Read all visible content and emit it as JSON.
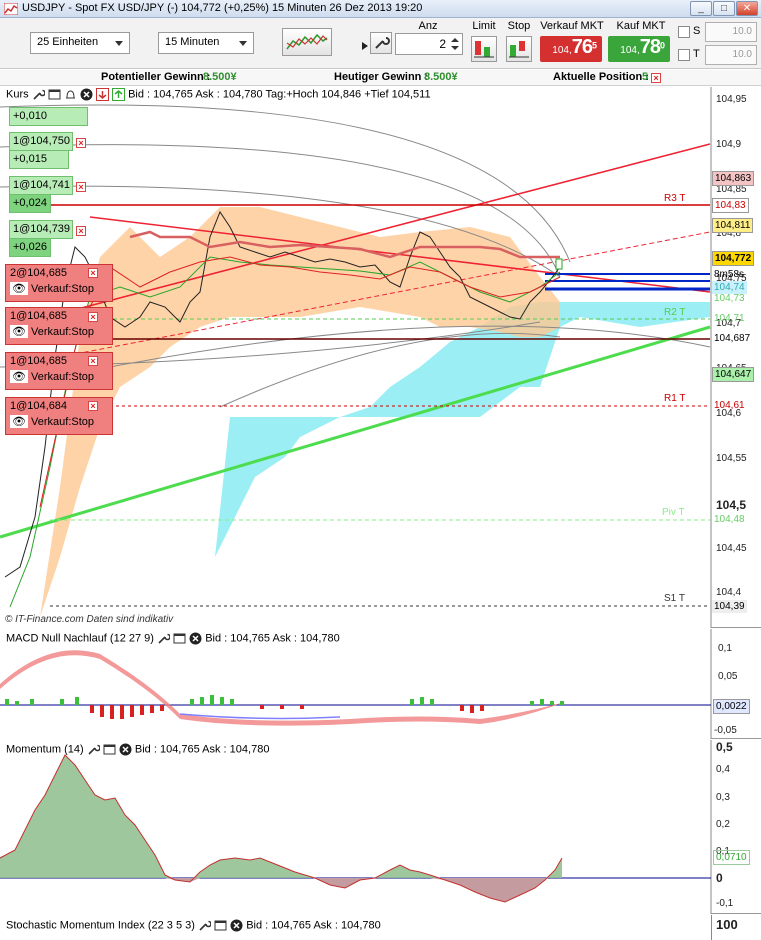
{
  "window": {
    "title": "USDJPY - Spot FX USD/JPY (-)    104,772 (+0,25%)    15 Minuten   26 Dez 2013 19:20",
    "buttons": {
      "minimize": "_",
      "maximize": "□",
      "close": "✕"
    }
  },
  "toolbar": {
    "units_select": "25 Einheiten",
    "interval_select": "15 Minuten",
    "anz_label": "Anz",
    "anz_value": "2",
    "limit_label": "Limit",
    "stop_label": "Stop",
    "sell_label": "Verkauf MKT",
    "buy_label": "Kauf MKT",
    "sell_price": {
      "small": "104,",
      "big": "76",
      "sup": "5"
    },
    "buy_price": {
      "small": "104,",
      "big": "78",
      "sup": "0"
    },
    "s_label": "S",
    "t_label": "T",
    "s_value": "10.0",
    "t_value": "10.0"
  },
  "infobar": {
    "potential_label": "Potentieller Gewinn :",
    "potential_value": "8.500¥",
    "today_label": "Heutiger Gewinn :",
    "today_value": "8.500¥",
    "position_label": "Aktuelle Position :",
    "position_value": "5"
  },
  "main_panel": {
    "title": "Kurs",
    "info": "Bid : 104,765 Ask : 104,780 Tag:+Hoch 104,846 +Tief 104,511",
    "credit": "© IT-Finance.com  Daten sind indikativ",
    "profit_boxes": [
      {
        "label": "+0,010"
      },
      {
        "label": "1@104,750"
      },
      {
        "label": "+0,015"
      },
      {
        "label": "1@104,741"
      },
      {
        "label": "+0,024"
      },
      {
        "label": "1@104,739"
      },
      {
        "label": "+0,026"
      }
    ],
    "orders": [
      {
        "qty": "2@104,685",
        "action": "Verkauf:Stop"
      },
      {
        "qty": "1@104,685",
        "action": "Verkauf:Stop"
      },
      {
        "qty": "1@104,685",
        "action": "Verkauf:Stop"
      },
      {
        "qty": "1@104,684",
        "action": "Verkauf:Stop"
      }
    ],
    "levels": [
      {
        "label": "R3 T"
      },
      {
        "label": "R2 T"
      },
      {
        "label": "R1 T"
      },
      {
        "label": "Piv T"
      },
      {
        "label": "S1 T"
      }
    ],
    "y_ticks": [
      "104,95",
      "104,9",
      "104,85",
      "104,8",
      "104,75",
      "104,7",
      "104,65",
      "104,6",
      "104,55",
      "104,5",
      "104,45",
      "104,4"
    ],
    "tags": [
      {
        "text": "104,863",
        "bg": "#f4c4c4",
        "fg": "#000"
      },
      {
        "text": "104,83",
        "bg": "#ffffff",
        "fg": "#cc0000"
      },
      {
        "text": "104,811",
        "bg": "#ffee88",
        "fg": "#000"
      },
      {
        "text": "104,772",
        "bg": "#ffd700",
        "fg": "#000"
      },
      {
        "text": "8m58s",
        "bg": "#ffffff",
        "fg": "#000"
      },
      {
        "text": "104,74",
        "bg": "#c8f0ff",
        "fg": "#3aa"
      },
      {
        "text": "104,73",
        "bg": "#ffffff",
        "fg": "#6c6"
      },
      {
        "text": "104,71",
        "bg": "#ffffff",
        "fg": "#6c6"
      },
      {
        "text": "104,687",
        "bg": "#ffffff",
        "fg": "#000"
      },
      {
        "text": "104,647",
        "bg": "#aaf0aa",
        "fg": "#000"
      },
      {
        "text": "104,61",
        "bg": "#ffffff",
        "fg": "#cc0000"
      },
      {
        "text": "104,48",
        "bg": "#ffffff",
        "fg": "#6c6"
      },
      {
        "text": "104,39",
        "bg": "#ffffff",
        "fg": "#000"
      }
    ]
  },
  "macd_panel": {
    "title": "MACD Null Nachlauf (12 27 9)",
    "info": "Bid : 104,765 Ask : 104,780",
    "y_ticks": [
      "0,1",
      "0,05",
      "-0,05"
    ],
    "tag": "0,0022"
  },
  "momentum_panel": {
    "title": "Momentum (14)",
    "info": "Bid : 104,765 Ask : 104,780",
    "y_ticks": [
      "0,5",
      "0,4",
      "0,3",
      "0,2",
      "0,1",
      "0",
      "-0,1"
    ],
    "tag": "0,0710"
  },
  "stoch_panel": {
    "title": "Stochastic Momentum Index (22 3 5 3)",
    "info": "Bid : 104,765 Ask : 104,780",
    "y_tick": "100"
  }
}
